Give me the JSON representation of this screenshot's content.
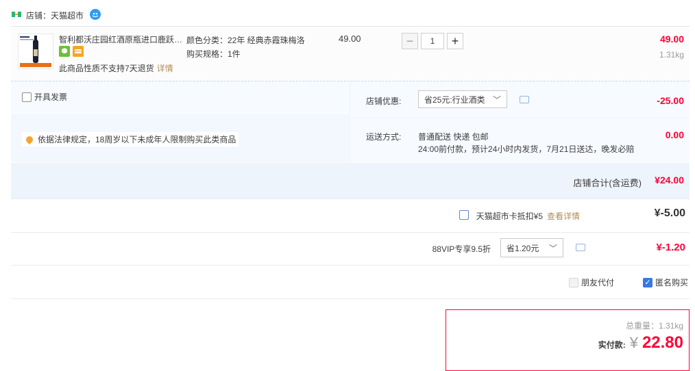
{
  "shop": {
    "label": "店铺：天猫超市"
  },
  "item": {
    "title": "智利都沃庄园红酒原瓶进口鹿跃…",
    "sku_color": "颜色分类：22年 经典赤霞珠梅洛",
    "sku_spec": "购买规格：1件",
    "note": "此商品性质不支持7天退货",
    "note_link": "详情",
    "unit_price": "49.00",
    "quantity": "1",
    "minus": "−",
    "plus": "+",
    "line_price": "49.00",
    "weight": "1.31kg"
  },
  "panel": {
    "invoice_label": "开具发票",
    "legal_notice": "依据法律规定，18周岁以下未成年人限制购买此类商品",
    "promo_label": "店铺优惠:",
    "promo_value": "省25元:行业酒类",
    "promo_amount": "-25.00",
    "shipping_label": "运送方式:",
    "shipping_line1": "普通配送 快递 包邮",
    "shipping_line2": "24:00前付款，预计24小时内发货，7月21日送达，晚发必赔",
    "shipping_amount": "0.00",
    "total_label": "店铺合计(含运费)",
    "total_amount": "¥24.00"
  },
  "card": {
    "label": "天猫超市卡抵扣¥5",
    "link": "查看详情",
    "amount": "¥-5.00"
  },
  "vip": {
    "label": "88VIP专享9.5折",
    "select_value": "省1.20元",
    "amount": "¥-1.20"
  },
  "options": {
    "friend_pay": "朋友代付",
    "anonymous": "匿名购买",
    "check_mark": "✓"
  },
  "summary": {
    "weight": "总重量：1.31kg",
    "pay_label": "实付款:",
    "yen": "¥",
    "amount": "22.80"
  },
  "icons": {
    "chevron": "﹀"
  },
  "colors": {
    "accent_red": "#ff0036",
    "link_gold": "#b28d5a",
    "panel_blue": "#f3f8fe",
    "checkbox_blue": "#3a78e0"
  }
}
